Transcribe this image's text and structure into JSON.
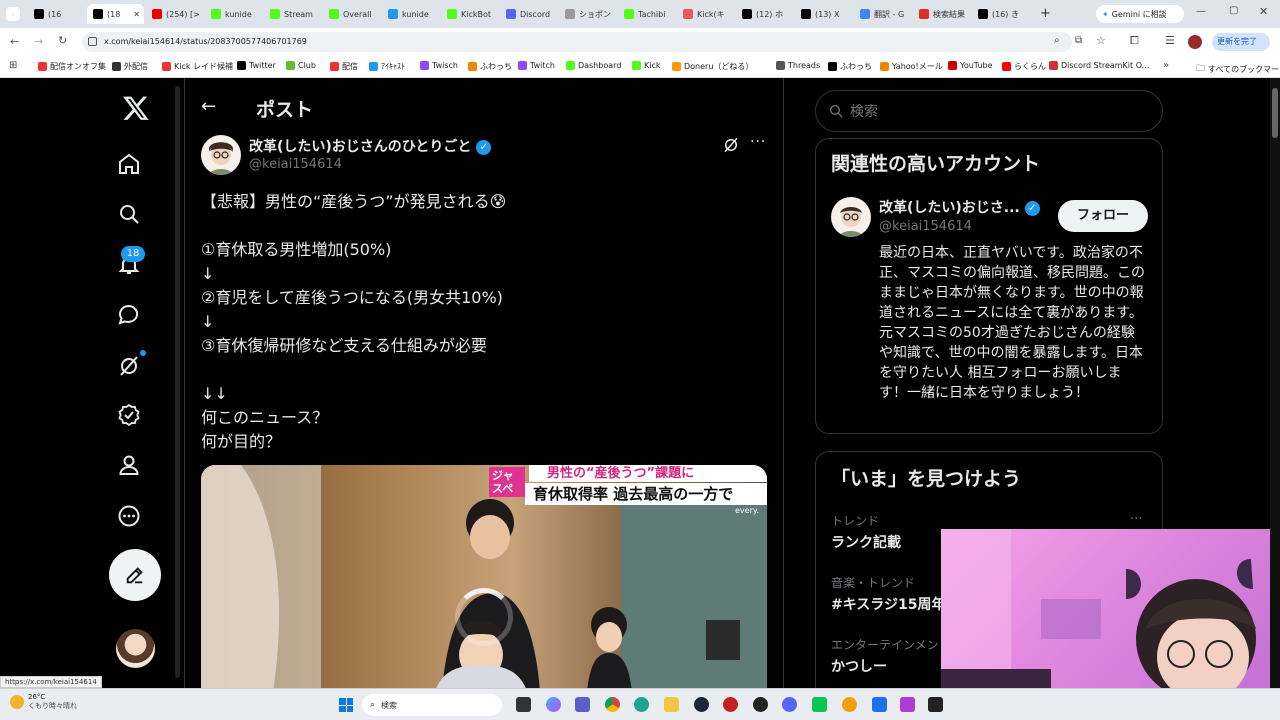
{
  "browser": {
    "tabs": [
      {
        "label": "(16"
      },
      {
        "label": "(18"
      },
      {
        "label": "(254) [>"
      },
      {
        "label": "kunide"
      },
      {
        "label": "Stream"
      },
      {
        "label": "Overall"
      },
      {
        "label": "kunide"
      },
      {
        "label": "KickBot"
      },
      {
        "label": "Discord"
      },
      {
        "label": "ショポン"
      },
      {
        "label": "Tachibi"
      },
      {
        "label": "Kick(キ"
      },
      {
        "label": "(12) ホ"
      },
      {
        "label": "(13) X"
      },
      {
        "label": "翻訳 - G"
      },
      {
        "label": "検索結果"
      },
      {
        "label": "(16) き"
      }
    ],
    "gemini_button": "Gemini に相談",
    "url": "x.com/keiai154614/status/2083700577406701769",
    "update_button": "更新を完了",
    "bookmarks": [
      "配信オンオフ集",
      "外配信",
      "Kick レイド候補",
      "Twitter",
      "Club",
      "配信",
      "ｱｲｷｬｽﾄ",
      "Twisch",
      "ふわっち",
      "Twitch",
      "Dashboard",
      "Kick",
      "Doneru（どねる）",
      "Threads",
      "ふわっち",
      "Yahoo!メール",
      "YouTube",
      "らくらん",
      "Discord StreamKit O..."
    ],
    "all_bookmarks": "すべてのブックマーク"
  },
  "nav": {
    "notification_count": "18"
  },
  "post": {
    "header_title": "ポスト",
    "author_name": "改革(したい)おじさんのひとりごと",
    "author_handle": "@keiai154614",
    "lines": [
      "【悲報】男性の“産後うつ”が発見される😰",
      "",
      "①育休取る男性増加(50%)",
      "↓",
      "②育児をして産後うつになる(男女共10%)",
      "↓",
      "③育休復帰研修など支える仕組みが必要",
      "",
      "↓↓",
      "何このニュース？",
      "何が目的？"
    ],
    "video_caption_top": "男性の“産後うつ”課題に",
    "video_caption_main": "育休取得率 過去最高の一方で",
    "video_caption_tag": "ジャスペ",
    "video_brand": "every."
  },
  "sidebar": {
    "search_placeholder": "検索",
    "related_title": "関連性の高いアカウント",
    "related_name": "改革(したい)おじさ...",
    "related_handle": "@keiai154614",
    "follow_label": "フォロー",
    "related_bio": "最近の日本、正直ヤバいです。政治家の不正、マスコミの偏向報道、移民問題。このままじゃ日本が無くなります。世の中の報道されるニュースには全て裏があります。元マスコミの50才過ぎたおじさんの経験や知識で、世の中の闇を暴露します。日本を守りたい人 相互フォローお願いします！一緒に日本を守りましょう！",
    "trends_title": "「いま」を見つけよう",
    "trends": [
      {
        "category": "トレンド",
        "name": "ランク記載"
      },
      {
        "category": "音楽・トレンド",
        "name": "#キスラジ15周年"
      },
      {
        "category": "エンターテインメント",
        "name": "かつしー"
      }
    ]
  },
  "status_link": "https://x.com/keiai154614",
  "taskbar": {
    "weather_temp": "26°C",
    "weather_desc": "くもり時々晴れ",
    "search_label": "検索"
  },
  "colors": {
    "accent": "#1d9bf0",
    "background": "#000000",
    "text": "#e7e9ea",
    "muted": "#71767b"
  }
}
